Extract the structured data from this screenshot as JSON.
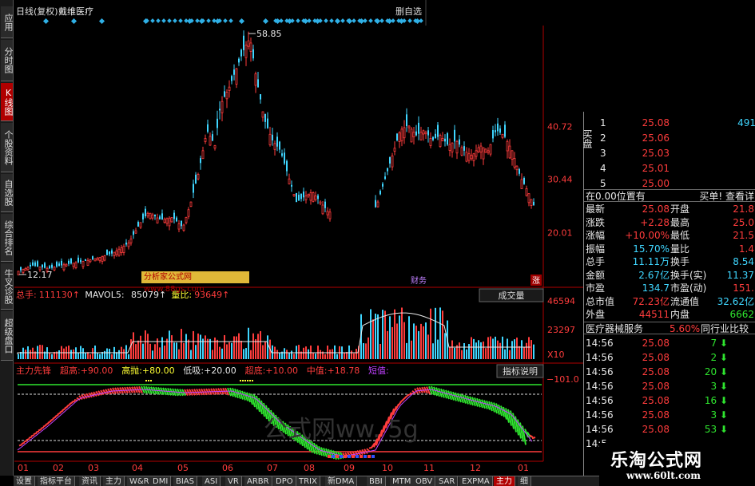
{
  "header": {
    "title": "日线(复权)",
    "stock_name": "戴维医疗",
    "right_button": "删自选"
  },
  "side_tabs": [
    "应用",
    "分时图",
    "K线图",
    "个股资料",
    "自选股",
    "综合排名",
    "牛叉诊股",
    "超级盘口"
  ],
  "side_active": 2,
  "price_chart": {
    "high_label": "58.85",
    "low_label": "12.17",
    "axis_labels": [
      "40.72",
      "30.44",
      "20.01"
    ],
    "watermark": "分析家公式网 www.88gs.com",
    "tags": [
      "财务",
      "涨"
    ]
  },
  "volume_panel": {
    "name": "总手",
    "value": "111130",
    "mavol_label": "MAVOL5",
    "mavol_value": "85079",
    "ratio_label": "量比",
    "ratio_value": "93649",
    "button": "成交量",
    "axis_labels": [
      "46594",
      "23297",
      "X10"
    ]
  },
  "indicator_panel": {
    "name": "主力先锋",
    "items": [
      {
        "label": "超高",
        "value": "+90.00",
        "color": "#ff3c3c"
      },
      {
        "label": "高抛",
        "value": "+80.00",
        "color": "#ffff33"
      },
      {
        "label": "低吸",
        "value": "+20.00",
        "color": "#e8e8e8"
      },
      {
        "label": "超底",
        "value": "+10.00",
        "color": "#ff3c3c"
      },
      {
        "label": "中值",
        "value": "+18.78",
        "color": "#ff3c3c"
      },
      {
        "label": "短值",
        "value": "",
        "color": "#c040ff"
      }
    ],
    "button": "指标说明",
    "axis_label": "101.0",
    "watermark": "公式网ww.            5g"
  },
  "months": [
    "01",
    "02",
    "03",
    "04",
    "05",
    "06",
    "07",
    "08",
    "09",
    "10",
    "11",
    "12",
    "01"
  ],
  "order_book": {
    "side_label_buy": "买盘",
    "levels": [
      {
        "level": "1",
        "price": "25.08",
        "vol": "491"
      },
      {
        "level": "2",
        "price": "25.06",
        "vol": ""
      },
      {
        "level": "3",
        "price": "25.03",
        "vol": ""
      },
      {
        "level": "4",
        "price": "25.01",
        "vol": ""
      },
      {
        "level": "5",
        "price": "25.00",
        "vol": ""
      }
    ],
    "status_left": "在0.00位置有",
    "status_right": "买单! 查看详"
  },
  "quote": {
    "rows": [
      {
        "l": "最新",
        "lv": "25.08",
        "r": "开盘",
        "rv": "21.8"
      },
      {
        "l": "涨跌",
        "lv": "+2.28",
        "r": "最高",
        "rv": "25.0"
      },
      {
        "l": "涨幅",
        "lv": "+10.00%",
        "r": "最低",
        "rv": "21.5"
      },
      {
        "l": "振幅",
        "lv": "15.70%",
        "r": "量比",
        "rv": "1.4"
      },
      {
        "l": "总手",
        "lv": "11.11万",
        "r": "换手",
        "rv": "8.54"
      },
      {
        "l": "金额",
        "lv": "2.67亿",
        "r": "换手(实)",
        "rv": "11.37"
      },
      {
        "l": "市盈",
        "lv": "134.7",
        "r": "市盈(动)",
        "rv": "151."
      },
      {
        "l": "总市值",
        "lv": "72.23亿",
        "r": "流通值",
        "rv": "32.62亿"
      },
      {
        "l": "外盘",
        "lv": "44511",
        "r": "内盘",
        "rv": "6662"
      }
    ],
    "sector": "医疗器械服务",
    "sector_pct": "5.60%",
    "sector_btn": "同行业比较"
  },
  "ticks": [
    {
      "t": "14:56",
      "p": "25.08",
      "v": "7"
    },
    {
      "t": "14:56",
      "p": "25.08",
      "v": "2"
    },
    {
      "t": "14:56",
      "p": "25.08",
      "v": "20"
    },
    {
      "t": "14:56",
      "p": "25.08",
      "v": "3"
    },
    {
      "t": "14:56",
      "p": "25.08",
      "v": "16"
    },
    {
      "t": "14:56",
      "p": "25.08",
      "v": "3"
    },
    {
      "t": "14:56",
      "p": "25.08",
      "v": "53"
    },
    {
      "t": "14:5",
      "p": "",
      "v": ""
    }
  ],
  "bottom_tabs": [
    "设置",
    "指标平台",
    "资讯",
    "主力",
    "W&R",
    "DMI",
    "BIAS",
    "ASI",
    "VR",
    "ARBR",
    "DPO",
    "TRIX",
    "新DMA",
    "BBI",
    "MTM",
    "OBV",
    "SAR",
    "EXPMA",
    "主力",
    "细"
  ],
  "logo": {
    "text": "乐淘公式网",
    "url": "www.60lt.com"
  },
  "colors": {
    "up": "#ff3c3c",
    "down": "#3fd6ff",
    "ma": "#e8e8e8"
  }
}
